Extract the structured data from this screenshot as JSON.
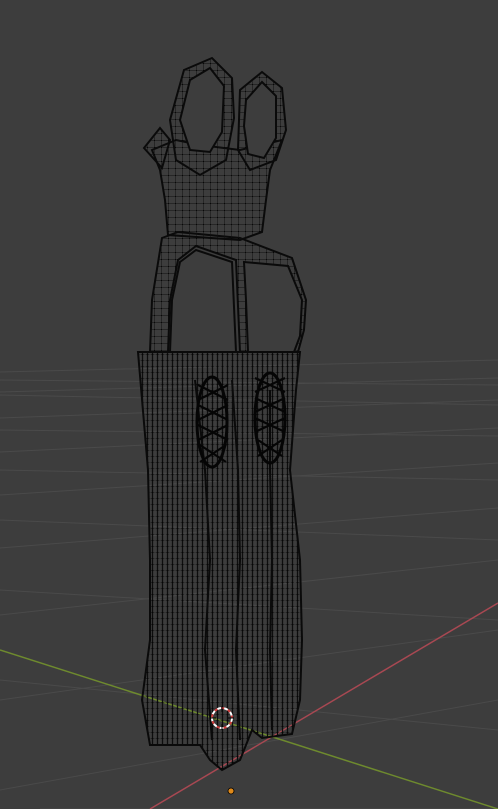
{
  "viewport": {
    "mode": "edit-mode-mesh-vertices",
    "background_color": "#3d3d3d",
    "grid_color": "#4a4a4a",
    "x_axis_color": "#a84852",
    "y_axis_color": "#6e8a2e",
    "mesh_color": "#0a0a0a",
    "cursor_color": "#ffffff",
    "cursor_accent_color": "#d23c3c",
    "origin_dot_color": "#e08a1a"
  },
  "icons": {
    "cursor": "3d-cursor-icon",
    "origin": "origin-dot-icon"
  }
}
